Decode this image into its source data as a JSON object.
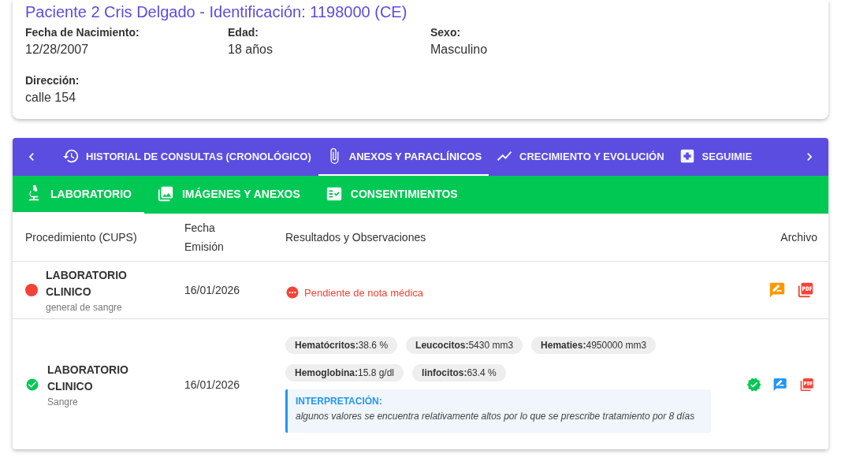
{
  "patient": {
    "title": "Paciente 2 Cris Delgado - Identificación: 1198000 (CE)",
    "fields": [
      {
        "label": "Fecha de Nacimiento:",
        "value": "12/28/2007"
      },
      {
        "label": "Edad:",
        "value": "18 años"
      },
      {
        "label": "Sexo:",
        "value": "Masculino"
      },
      {
        "label": "Dirección:",
        "value": "calle 154"
      }
    ]
  },
  "tabs": [
    {
      "label": "HISTORIAL DE CONSULTAS (CRONOLÓGICO)",
      "kind": "history",
      "selected": false
    },
    {
      "label": "ANEXOS Y PARACLÍNICOS",
      "kind": "clip",
      "selected": true
    },
    {
      "label": "CRECIMIENTO Y EVOLUCIÓN",
      "kind": "trend",
      "selected": false
    },
    {
      "label": "SEGUIMIE",
      "kind": "plus",
      "selected": false
    }
  ],
  "subtabs": [
    {
      "label": "LABORATORIO",
      "kind": "microscope",
      "selected": true
    },
    {
      "label": "IMÁGENES Y ANEXOS",
      "kind": "images",
      "selected": false
    },
    {
      "label": "CONSENTIMIENTOS",
      "kind": "checklist",
      "selected": false
    }
  ],
  "table": {
    "columns": [
      "Procedimiento (CUPS)",
      "Fecha Emisión",
      "Resultados y Observaciones",
      "Archivo"
    ],
    "rows": [
      {
        "kind": "pending",
        "name": "LABORATORIO CLINICO",
        "detail": "general de sangre",
        "date": "16/01/2026",
        "note": "Pendiente de nota médica",
        "actions": [
          {
            "kind": "comment",
            "color": "#ff9800"
          },
          {
            "kind": "pdf"
          }
        ]
      },
      {
        "kind": "done",
        "name": "LABORATORIO CLINICO",
        "detail": "Sangre",
        "date": "16/01/2026",
        "results": [
          "**Hematócritos:**38.6 %",
          "**Leucocitos:**5430 mm3",
          "**Hematies:**4950000 mm3",
          "**Hemoglobina:**15.8 g/dl",
          "**linfocitos:**63.4 %"
        ],
        "interpretation": {
          "title": "INTERPRETACIÓN:",
          "text": "algunos valores se encuentra relativamente altos por lo que se prescribe tratamiento por 8 días"
        },
        "actions": [
          {
            "kind": "verified"
          },
          {
            "kind": "comment",
            "color": "#2196f3"
          },
          {
            "kind": "pdf"
          }
        ]
      }
    ]
  }
}
